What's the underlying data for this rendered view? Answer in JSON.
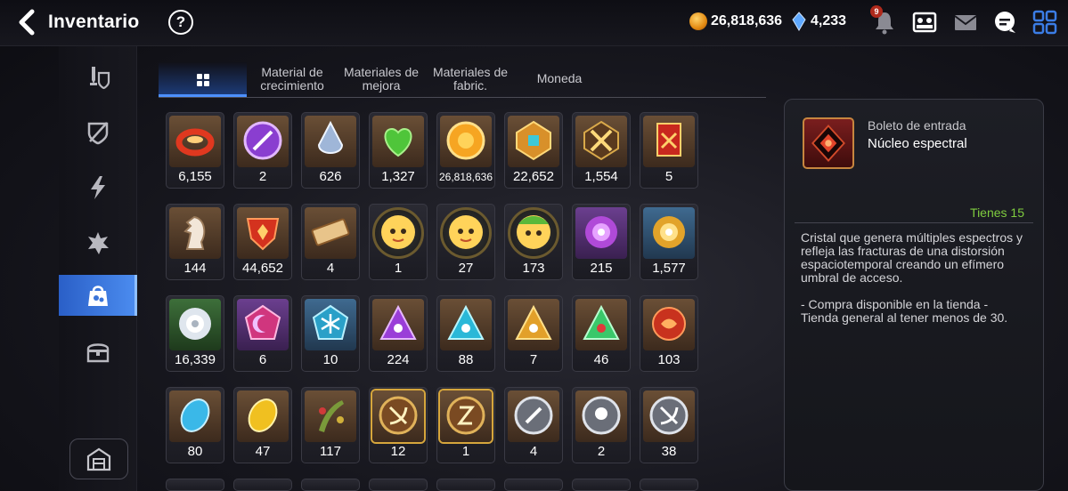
{
  "header": {
    "title": "Inventario",
    "help_label": "?",
    "gold": "26,818,636",
    "crystals": "4,233",
    "notification_count": "9"
  },
  "tabs": [
    {
      "label": "",
      "icon": "grid-icon",
      "active": true
    },
    {
      "label": "Material de crecimiento"
    },
    {
      "label": "Materiales de mejora"
    },
    {
      "label": "Materiales de fabric."
    },
    {
      "label": "Moneda"
    }
  ],
  "sidebar": {
    "items": [
      {
        "icon": "equipment-icon"
      },
      {
        "icon": "artifact-icon"
      },
      {
        "icon": "lightning-icon"
      },
      {
        "icon": "catalyst-icon"
      },
      {
        "icon": "bag-icon",
        "active": true
      },
      {
        "icon": "chest-icon"
      }
    ],
    "store_icon": "storage-icon"
  },
  "items": [
    {
      "icon": "ring-red",
      "count": "6,155",
      "frame": ""
    },
    {
      "icon": "skill-charm",
      "count": "2",
      "frame": ""
    },
    {
      "icon": "teardrop-gem",
      "count": "626",
      "frame": ""
    },
    {
      "icon": "green-heart",
      "count": "1,327",
      "frame": ""
    },
    {
      "icon": "sun-medal",
      "count": "26,818,636",
      "frame": "",
      "small": true
    },
    {
      "icon": "gold-emblem",
      "count": "22,652",
      "frame": ""
    },
    {
      "icon": "crossed-emblem",
      "count": "1,554",
      "frame": ""
    },
    {
      "icon": "banner",
      "count": "5",
      "frame": ""
    },
    {
      "icon": "chess-knight",
      "count": "144",
      "frame": ""
    },
    {
      "icon": "fire-crest",
      "count": "44,652",
      "frame": ""
    },
    {
      "icon": "ticket",
      "count": "4",
      "frame": ""
    },
    {
      "icon": "hero-face",
      "count": "1",
      "frame": "hero"
    },
    {
      "icon": "hero-face",
      "count": "27",
      "frame": "hero"
    },
    {
      "icon": "hero-face-green",
      "count": "173",
      "frame": "hero"
    },
    {
      "icon": "purple-flower",
      "count": "215",
      "frame": "purple"
    },
    {
      "icon": "gold-flower",
      "count": "1,577",
      "frame": "blue"
    },
    {
      "icon": "white-flower",
      "count": "16,339",
      "frame": "green"
    },
    {
      "icon": "moon-crystal",
      "count": "6",
      "frame": "purple"
    },
    {
      "icon": "snow-crystal",
      "count": "10",
      "frame": "blue"
    },
    {
      "icon": "pyramid-purple",
      "count": "224",
      "frame": ""
    },
    {
      "icon": "pyramid-cyan",
      "count": "88",
      "frame": ""
    },
    {
      "icon": "pyramid-gold",
      "count": "7",
      "frame": ""
    },
    {
      "icon": "pyramid-green",
      "count": "46",
      "frame": ""
    },
    {
      "icon": "red-orb",
      "count": "103",
      "frame": ""
    },
    {
      "icon": "blue-stone",
      "count": "80",
      "frame": ""
    },
    {
      "icon": "yellow-stone",
      "count": "47",
      "frame": ""
    },
    {
      "icon": "plant-bundle",
      "count": "117",
      "frame": ""
    },
    {
      "icon": "bow-medal",
      "count": "12",
      "frame": "gold-frame"
    },
    {
      "icon": "rune-medal",
      "count": "1",
      "frame": "gold-frame"
    },
    {
      "icon": "silver-medal-1",
      "count": "4",
      "frame": ""
    },
    {
      "icon": "silver-medal-2",
      "count": "2",
      "frame": ""
    },
    {
      "icon": "silver-medal-3",
      "count": "38",
      "frame": ""
    }
  ],
  "detail": {
    "category": "Boleto de entrada",
    "name": "Núcleo espectral",
    "owned": "Tienes 15",
    "description": "Cristal que genera múltiples espectros y refleja las fracturas de una distorsión espaciotemporal creando un efímero umbral de acceso.\n\n- Compra disponible en la tienda -\nTienda general al tener menos de 30."
  },
  "colors": {
    "accent_blue": "#4c8df0",
    "owned_green": "#7fcc3f",
    "panel_border": "#3b3c46"
  }
}
